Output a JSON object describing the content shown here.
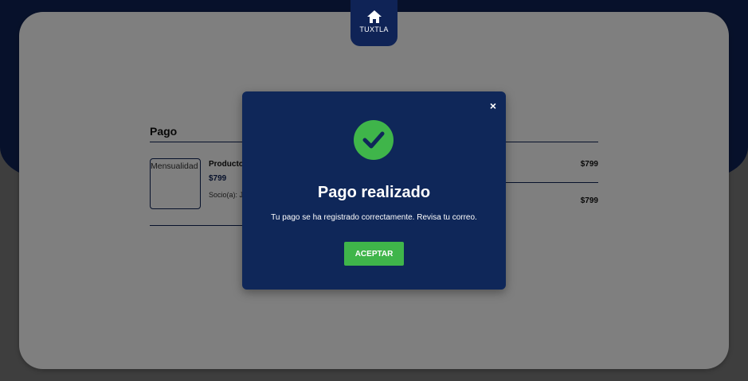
{
  "nav": {
    "home_label": "TUXTLA"
  },
  "payment": {
    "title": "Pago",
    "item": {
      "image_alt": "Mensualidad",
      "name": "Producto",
      "price": "$799",
      "member_label": "Socio(a): J"
    },
    "line_total": "$799",
    "total": "$799"
  },
  "modal": {
    "close": "×",
    "title": "Pago realizado",
    "message": "Tu pago se ha registrado correctamente. Revisa tu correo.",
    "accept_label": "ACEPTAR"
  },
  "colors": {
    "navy": "#0f2356",
    "success": "#3fb54a"
  }
}
